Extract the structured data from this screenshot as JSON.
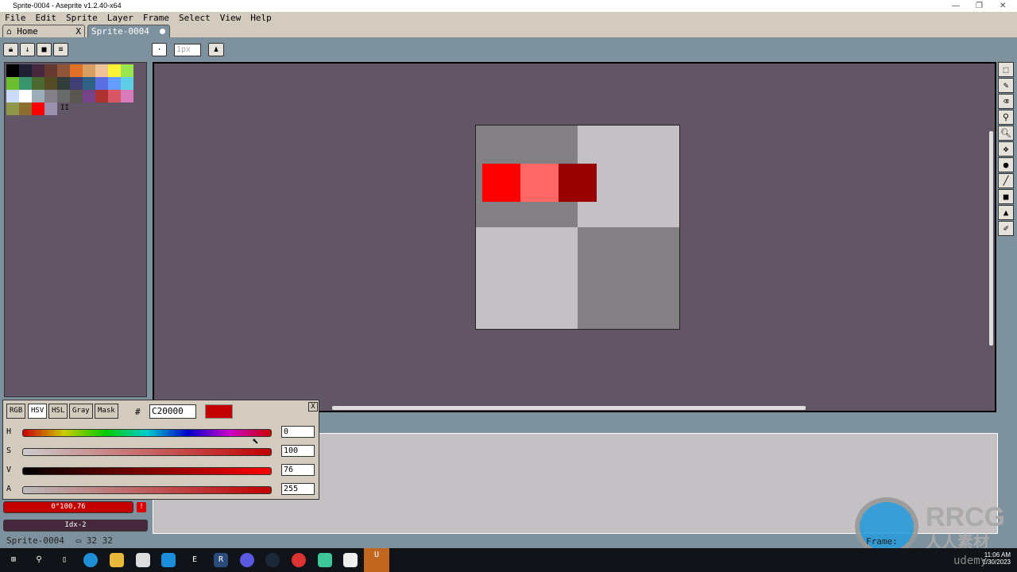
{
  "window": {
    "title": "Sprite-0004 - Aseprite v1.2.40-x64"
  },
  "menu": [
    "File",
    "Edit",
    "Sprite",
    "Layer",
    "Frame",
    "Select",
    "View",
    "Help"
  ],
  "tabs": [
    {
      "label": "Home",
      "close": "X"
    },
    {
      "label": "Sprite-0004"
    }
  ],
  "toolbar": {
    "brush_size": "1px"
  },
  "palette": {
    "colors": [
      "#000000",
      "#222034",
      "#45283c",
      "#663931",
      "#8f563b",
      "#df7126",
      "#d9a066",
      "#eec39a",
      "#fbf236",
      "#99e550",
      "#6abe30",
      "#37946e",
      "#4b692f",
      "#524b24",
      "#323c39",
      "#3f3f74",
      "#306082",
      "#5b6ee1",
      "#639bff",
      "#5fcde4",
      "#cbdbfc",
      "#ffffff",
      "#9badb7",
      "#847e87",
      "#696a6a",
      "#595652",
      "#76428a",
      "#ac3232",
      "#d95763",
      "#d77bba",
      "#8f974a",
      "#8a6f30",
      "#ff0000",
      "#9a90b0"
    ],
    "resize_handle": "II"
  },
  "sprite": {
    "checker_dark": "#838083",
    "checker_light": "#c4c0c4",
    "pixels": [
      "#ff0000",
      "#ff6666",
      "#990000"
    ]
  },
  "color_panel": {
    "modes": [
      "RGB",
      "HSV",
      "HSL",
      "Gray",
      "Mask"
    ],
    "active_mode": "HSV",
    "hash": "#",
    "hex": "C20000",
    "sliders": [
      {
        "label": "H",
        "value": "0"
      },
      {
        "label": "S",
        "value": "100"
      },
      {
        "label": "V",
        "value": "76"
      },
      {
        "label": "A",
        "value": "255"
      }
    ],
    "close": "X"
  },
  "fg_color": {
    "label": "0°100,76",
    "color": "#c20000",
    "warning": "!"
  },
  "bg_color": {
    "label": "Idx-2",
    "color": "#45283c"
  },
  "status": {
    "sprite": "Sprite-0004",
    "size": "32 32"
  },
  "clock": {
    "time": "11:06 AM",
    "date": "1/30/2023"
  },
  "watermark": {
    "text": "RRCG",
    "sub": "人人素材",
    "udemy": "udemy",
    "frame": "Frame:"
  }
}
